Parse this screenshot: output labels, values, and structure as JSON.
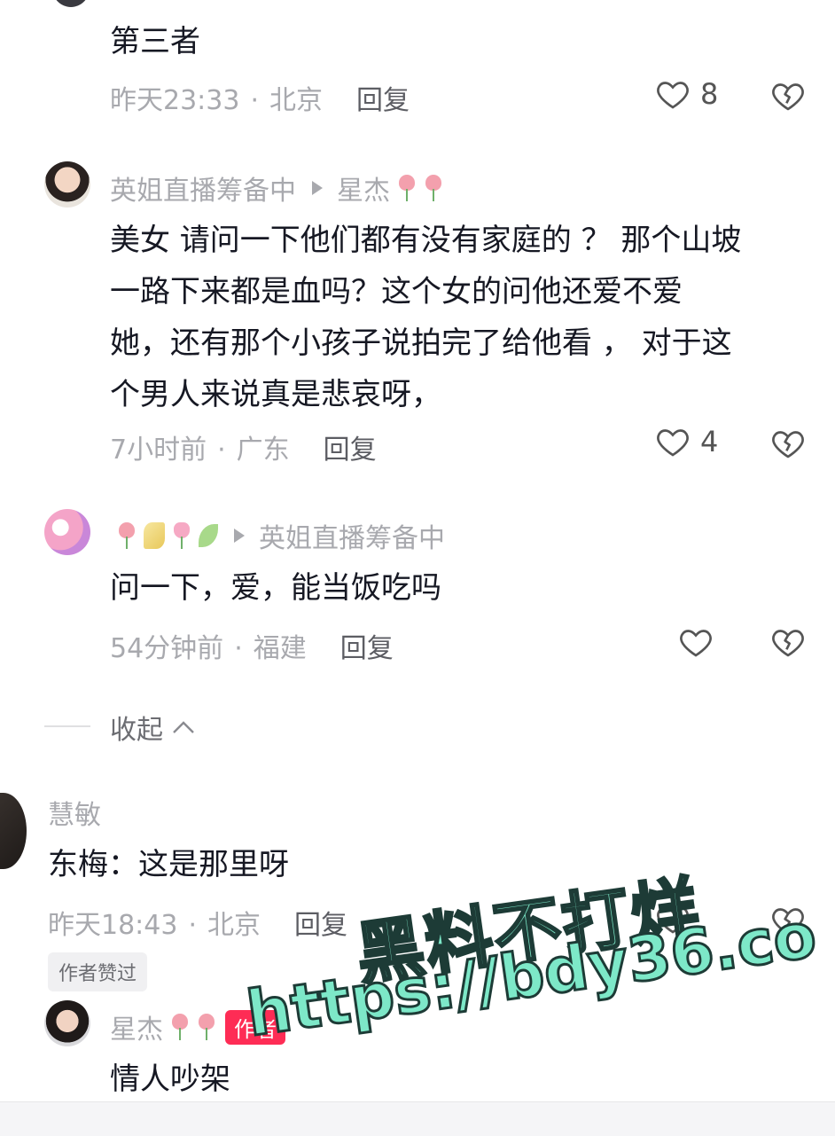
{
  "comments": [
    {
      "text": "第三者",
      "time": "昨天23:33",
      "location": "北京",
      "reply_label": "回复",
      "like_count": "8"
    },
    {
      "user": "英姐直播筹备中",
      "reply_to": "星杰",
      "text_lines": [
        "美女 请问一下他们都有没有家庭的 ？ 那个山坡",
        "一路下来都是血吗？这个女的问他还爱不爱",
        "她，还有那个小孩子说拍完了给他看 ， 对于这",
        "个男人来说真是悲哀呀，"
      ],
      "time": "7小时前",
      "location": "广东",
      "reply_label": "回复",
      "like_count": "4"
    },
    {
      "reply_to": "英姐直播筹备中",
      "text": "问一下，爱，能当饭吃吗",
      "time": "54分钟前",
      "location": "福建",
      "reply_label": "回复",
      "like_count": ""
    }
  ],
  "collapse_label": "收起",
  "main_comment": {
    "user": "慧敏",
    "text": "东梅：这是那里呀",
    "time": "昨天18:43",
    "location": "北京",
    "reply_label": "回复",
    "author_liked": "作者赞过"
  },
  "author_reply": {
    "user": "星杰",
    "author_tag": "作者",
    "text": "情人吵架"
  },
  "watermark": {
    "line1": "黑料不打烊",
    "line2": "https://bdy36.co"
  },
  "colors": {
    "accent": "#fe2c55",
    "meta": "#a8a9ae",
    "watermark": "#7de8c8"
  }
}
